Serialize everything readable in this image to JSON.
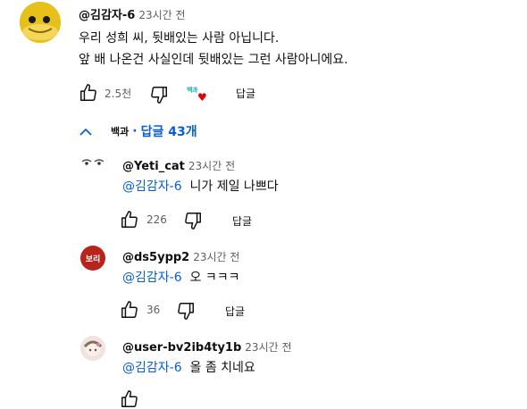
{
  "comment": {
    "author": "@김감자-6",
    "time": "23시간 전",
    "lines": [
      "우리 성희 씨, 뒷배있는 사람 아닙니다.",
      "앞 배 나온건 사실인데 뒷배있는 그런 사람아니에요."
    ],
    "likes": "2.5천",
    "reply_label": "답글",
    "hearted_by": "백과"
  },
  "replies_toggle": {
    "label": "답글 43개",
    "channel_badge": "백과"
  },
  "replies": [
    {
      "author": "@Yeti_cat",
      "time": "23시간 전",
      "mention": "@김감자-6",
      "text": "니가 제일 나쁘다",
      "likes": "226",
      "reply_label": "답글"
    },
    {
      "author": "@ds5ypp2",
      "time": "23시간 전",
      "mention": "@김감자-6",
      "text": "오 ㅋㅋㅋ",
      "likes": "36",
      "reply_label": "답글",
      "avatar_text": "보리"
    },
    {
      "author": "@user-bv2ib4ty1b",
      "time": "23시간 전",
      "mention": "@김감자-6",
      "text": "올 좀 치네요"
    }
  ],
  "colors": {
    "link": "#065fd4",
    "meta": "#606060",
    "heart": "#e00000"
  }
}
